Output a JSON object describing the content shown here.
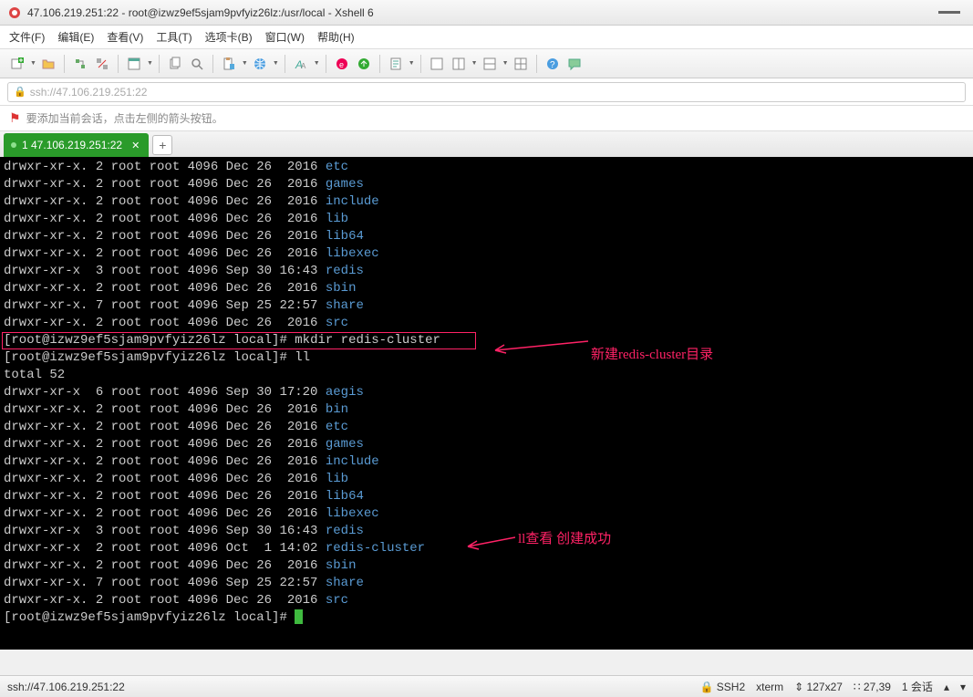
{
  "window": {
    "title": "47.106.219.251:22 - root@izwz9ef5sjam9pvfyiz26lz:/usr/local - Xshell 6"
  },
  "menu": {
    "file": "文件(F)",
    "edit": "编辑(E)",
    "view": "查看(V)",
    "tools": "工具(T)",
    "tabs": "选项卡(B)",
    "window": "窗口(W)",
    "help": "帮助(H)"
  },
  "address": {
    "text": "ssh://47.106.219.251:22"
  },
  "tip": {
    "text": "要添加当前会话，点击左侧的箭头按钮。"
  },
  "tab": {
    "label": "1 47.106.219.251:22"
  },
  "annotations": {
    "a1": "新建redis-cluster目录",
    "a2": "ll查看  创建成功"
  },
  "terminal": {
    "lines": [
      {
        "perm": "drwxr-xr-x. 2 root root 4096 Dec 26  2016 ",
        "name": "etc"
      },
      {
        "perm": "drwxr-xr-x. 2 root root 4096 Dec 26  2016 ",
        "name": "games"
      },
      {
        "perm": "drwxr-xr-x. 2 root root 4096 Dec 26  2016 ",
        "name": "include"
      },
      {
        "perm": "drwxr-xr-x. 2 root root 4096 Dec 26  2016 ",
        "name": "lib"
      },
      {
        "perm": "drwxr-xr-x. 2 root root 4096 Dec 26  2016 ",
        "name": "lib64"
      },
      {
        "perm": "drwxr-xr-x. 2 root root 4096 Dec 26  2016 ",
        "name": "libexec"
      },
      {
        "perm": "drwxr-xr-x  3 root root 4096 Sep 30 16:43 ",
        "name": "redis"
      },
      {
        "perm": "drwxr-xr-x. 2 root root 4096 Dec 26  2016 ",
        "name": "sbin"
      },
      {
        "perm": "drwxr-xr-x. 7 root root 4096 Sep 25 22:57 ",
        "name": "share"
      },
      {
        "perm": "drwxr-xr-x. 2 root root 4096 Dec 26  2016 ",
        "name": "src"
      }
    ],
    "cmd1_prompt": "[root@izwz9ef5sjam9pvfyiz26lz local]# ",
    "cmd1": "mkdir redis-cluster",
    "cmd2_prompt": "[root@izwz9ef5sjam9pvfyiz26lz local]# ",
    "cmd2": "ll",
    "total": "total 52",
    "lines2": [
      {
        "perm": "drwxr-xr-x  6 root root 4096 Sep 30 17:20 ",
        "name": "aegis"
      },
      {
        "perm": "drwxr-xr-x. 2 root root 4096 Dec 26  2016 ",
        "name": "bin"
      },
      {
        "perm": "drwxr-xr-x. 2 root root 4096 Dec 26  2016 ",
        "name": "etc"
      },
      {
        "perm": "drwxr-xr-x. 2 root root 4096 Dec 26  2016 ",
        "name": "games"
      },
      {
        "perm": "drwxr-xr-x. 2 root root 4096 Dec 26  2016 ",
        "name": "include"
      },
      {
        "perm": "drwxr-xr-x. 2 root root 4096 Dec 26  2016 ",
        "name": "lib"
      },
      {
        "perm": "drwxr-xr-x. 2 root root 4096 Dec 26  2016 ",
        "name": "lib64"
      },
      {
        "perm": "drwxr-xr-x. 2 root root 4096 Dec 26  2016 ",
        "name": "libexec"
      },
      {
        "perm": "drwxr-xr-x  3 root root 4096 Sep 30 16:43 ",
        "name": "redis"
      },
      {
        "perm": "drwxr-xr-x  2 root root 4096 Oct  1 14:02 ",
        "name": "redis-cluster"
      },
      {
        "perm": "drwxr-xr-x. 2 root root 4096 Dec 26  2016 ",
        "name": "sbin"
      },
      {
        "perm": "drwxr-xr-x. 7 root root 4096 Sep 25 22:57 ",
        "name": "share"
      },
      {
        "perm": "drwxr-xr-x. 2 root root 4096 Dec 26  2016 ",
        "name": "src"
      }
    ],
    "last_prompt": "[root@izwz9ef5sjam9pvfyiz26lz local]# "
  },
  "status": {
    "left": "ssh://47.106.219.251:22",
    "ssh": "SSH2",
    "term": "xterm",
    "size": "127x27",
    "pos": "27,39",
    "sessions": "1 会话"
  }
}
